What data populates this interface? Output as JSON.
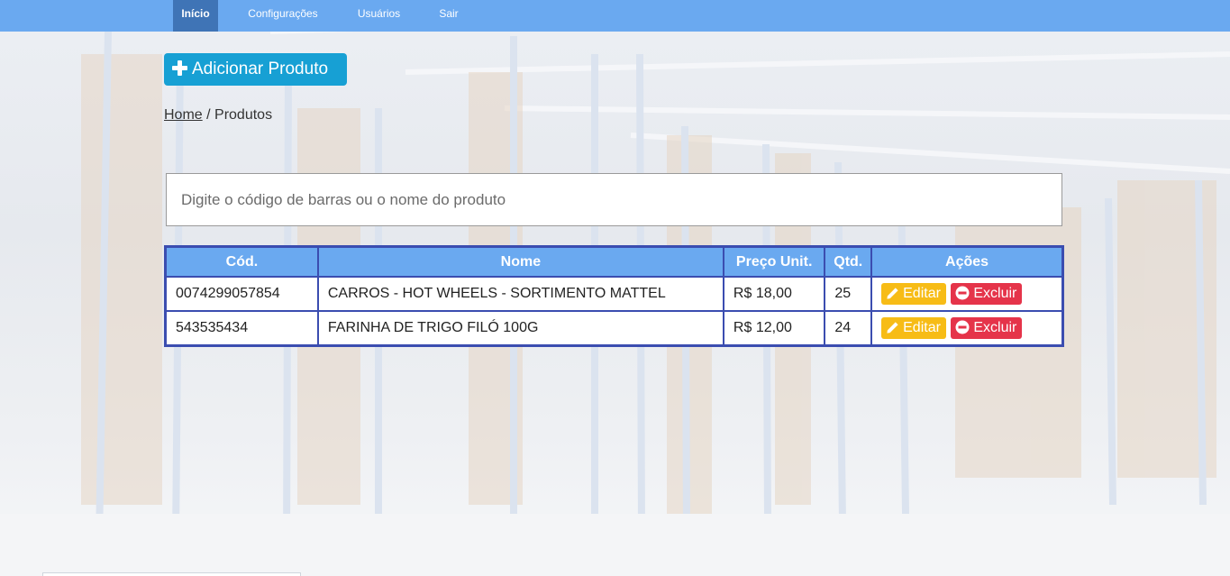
{
  "nav": {
    "items": [
      {
        "label": "Início",
        "active": true
      },
      {
        "label": "Configurações",
        "active": false
      },
      {
        "label": "Usuários",
        "active": false
      },
      {
        "label": "Sair",
        "active": false
      }
    ]
  },
  "add_button": {
    "label": "Adicionar Produto",
    "icon": "plus-icon"
  },
  "breadcrumb": {
    "home": "Home",
    "separator": " / ",
    "current": "Produtos"
  },
  "search": {
    "placeholder": "Digite o código de barras ou o nome do produto",
    "value": ""
  },
  "table": {
    "headers": [
      "Cód.",
      "Nome",
      "Preço Unit.",
      "Qtd.",
      "Ações"
    ],
    "rows": [
      {
        "cod": "0074299057854",
        "nome": "CARROS - HOT WHEELS - SORTIMENTO MATTEL",
        "preco": "R$ 18,00",
        "qtd": "25"
      },
      {
        "cod": "543535434",
        "nome": "FARINHA DE TRIGO FILÓ 100G",
        "preco": "R$ 12,00",
        "qtd": "24"
      }
    ],
    "actions": {
      "edit_label": "Editar",
      "delete_label": "Excluir"
    }
  },
  "colors": {
    "nav_bg": "#6aa9f0",
    "nav_active": "#3f74b6",
    "add_button": "#17a0d4",
    "table_border": "#3b4db0",
    "edit_button": "#f7bc16",
    "delete_button": "#e5344a"
  }
}
